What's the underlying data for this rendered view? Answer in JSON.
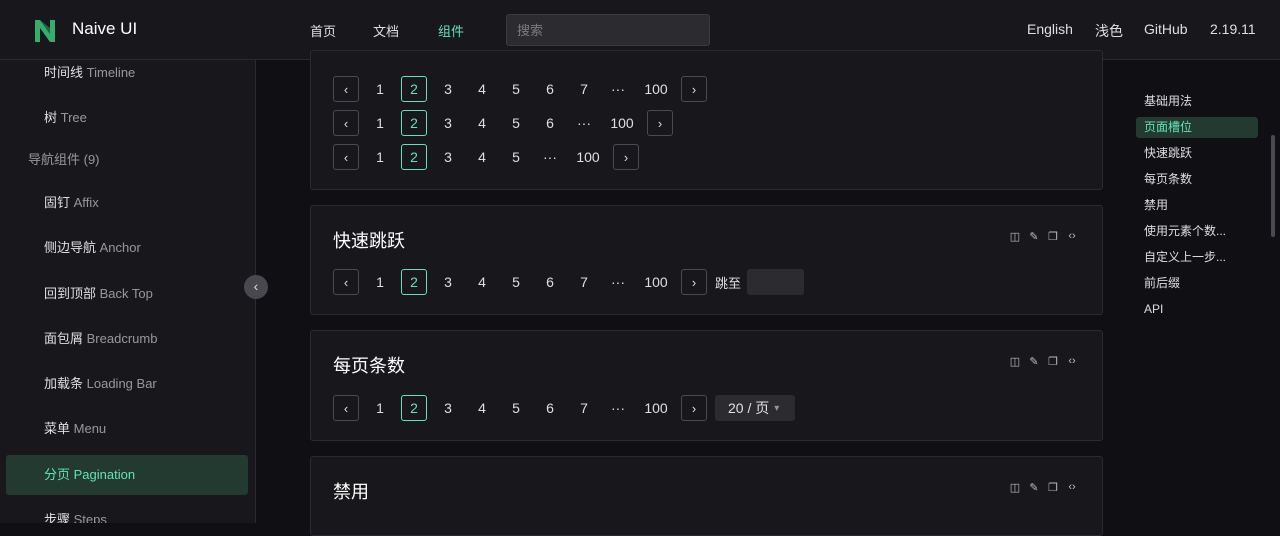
{
  "header": {
    "brand": "Naive UI",
    "nav": [
      "首页",
      "文档",
      "组件"
    ],
    "search_placeholder": "搜索",
    "right": [
      "English",
      "浅色",
      "GitHub",
      "2.19.11"
    ]
  },
  "sidebar": {
    "items": [
      {
        "zh": "时间线",
        "en": "Timeline"
      },
      {
        "zh": "树",
        "en": "Tree"
      },
      {
        "zh": "导航组件 (9)",
        "en": ""
      },
      {
        "zh": "固钉",
        "en": "Affix"
      },
      {
        "zh": "侧边导航",
        "en": "Anchor"
      },
      {
        "zh": "回到顶部",
        "en": "Back Top"
      },
      {
        "zh": "面包屑",
        "en": "Breadcrumb"
      },
      {
        "zh": "加载条",
        "en": "Loading Bar"
      },
      {
        "zh": "菜单",
        "en": "Menu"
      },
      {
        "zh": "分页",
        "en": "Pagination"
      },
      {
        "zh": "步骤",
        "en": "Steps"
      }
    ],
    "collapse_icon": "‹"
  },
  "pager": {
    "prev": "‹",
    "next": "›",
    "ellipsis": "···",
    "p": [
      "1",
      "2",
      "3",
      "4",
      "5",
      "6",
      "7"
    ],
    "last": "100"
  },
  "cards": {
    "quick_jump": {
      "title": "快速跳跃",
      "jump_label": "跳至"
    },
    "page_size": {
      "title": "每页条数",
      "size_value": "20 / 页",
      "arrow": "▾"
    },
    "disabled": {
      "title": "禁用"
    },
    "tools": [
      "◫",
      "✎",
      "❐",
      "‹›"
    ]
  },
  "anchors": [
    "基础用法",
    "页面槽位",
    "快速跳跃",
    "每页条数",
    "禁用",
    "使用元素个数...",
    "自定义上一步...",
    "前后缀",
    "API"
  ],
  "colors": {
    "accent": "#63e2b7",
    "bg": "#101014",
    "surface": "#18181c"
  }
}
